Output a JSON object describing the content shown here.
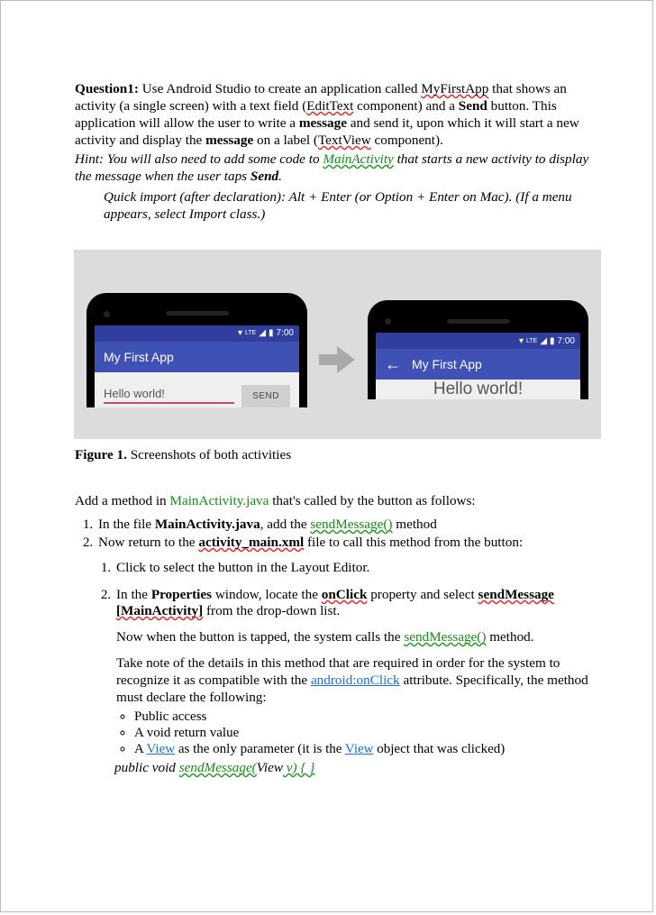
{
  "q1": {
    "label": "Question1:",
    "text1": " Use Android Studio to create an application called ",
    "app": "MyFirstApp",
    "text2": " that shows an activity (a single screen) with a text field (",
    "edittext": "EditText",
    "text3": " component) and a ",
    "send": "Send",
    "text4": " button. This application will allow the user to write a ",
    "message": "message",
    "text5": " and send it, upon which it will start a new activity and display the ",
    "message2": "message",
    "text6": " on a label (",
    "textview": "TextView",
    "text7": " component)."
  },
  "hint": {
    "pre": "Hint: You will also need to add some code to ",
    "main": "MainActivity",
    "mid": " that starts a new activity to display the message when the user taps ",
    "send": "Send",
    "end": "."
  },
  "quick": "Quick import (after declaration): Alt + Enter (or Option + Enter on Mac). (If a menu appears, select Import class.)",
  "mock": {
    "time": "7:00",
    "title": "My First App",
    "input": "Hello world!",
    "send": "SEND",
    "result": "Hello world!"
  },
  "caption": {
    "fig": "Figure 1.",
    "text": " Screenshots of both activities"
  },
  "intro2": {
    "pre": "Add a method in ",
    "file": "MainActivity.java",
    "post": " that's called by the button as follows:"
  },
  "step1": {
    "pre": "In the file ",
    "file": "MainActivity.java",
    "mid": ", add the ",
    "method": "sendMessage()",
    "post": " method"
  },
  "step2": {
    "pre": "Now return to the ",
    "file": "activity_main.xml",
    "post": " file to call this method from the button:"
  },
  "sub1": "Click to select the button in the Layout Editor.",
  "sub2": {
    "l1a": "In the ",
    "props": "Properties",
    "l1b": " window, locate the ",
    "onclick": "onClick",
    "l1c": " property and select ",
    "choice": "sendMessage [MainActivity]",
    "l1d": " from the drop-down list.",
    "p2a": "Now when the button is tapped, the system calls the ",
    "method": "sendMessage()",
    "p2b": " method.",
    "p3a": "Take note of the details in this method that are required in order for the system to recognize it as compatible with the ",
    "attr": "android:onClick",
    "p3b": " attribute. Specifically, the method must declare the following:",
    "b1": "Public access",
    "b2": "A void return value",
    "b3a": "A ",
    "view": "View",
    "b3b": " as the only parameter (it is the ",
    "b3c": " object that was clicked)",
    "sig1": "public void ",
    "sigm": "sendMessage(",
    "sigv": "View",
    "sig2": " v) { }"
  }
}
